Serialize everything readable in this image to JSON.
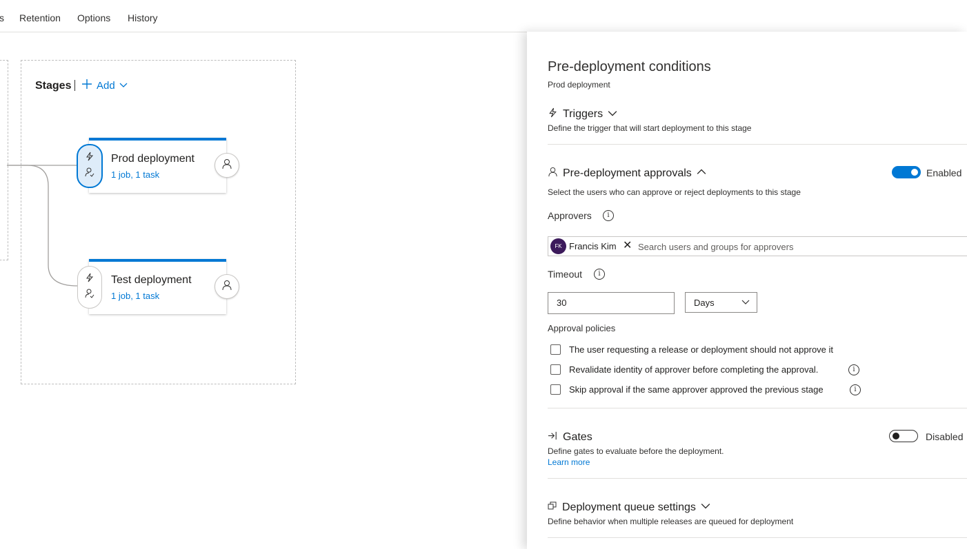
{
  "topnav": {
    "tabs": [
      {
        "label": "s"
      },
      {
        "label": "Retention"
      },
      {
        "label": "Options"
      },
      {
        "label": "History"
      }
    ]
  },
  "pipeline": {
    "stages_title": "Stages",
    "add_label": "Add",
    "stages": [
      {
        "name": "Prod deployment",
        "summary": "1 job, 1 task"
      },
      {
        "name": "Test deployment",
        "summary": "1 job, 1 task"
      }
    ]
  },
  "panel": {
    "title": "Pre-deployment conditions",
    "subtitle": "Prod deployment",
    "triggers": {
      "title": "Triggers",
      "description": "Define the trigger that will start deployment to this stage"
    },
    "approvals": {
      "title": "Pre-deployment approvals",
      "toggle_label": "Enabled",
      "enabled": true,
      "description": "Select the users who can approve or reject deployments to this stage",
      "approvers_label": "Approvers",
      "approver_initials": "FK",
      "approver_name": "Francis Kim",
      "search_placeholder": "Search users and groups for approvers",
      "timeout_label": "Timeout",
      "timeout_value": "30",
      "timeout_unit": "Days",
      "policies_label": "Approval policies",
      "policies": [
        {
          "label": "The user requesting a release or deployment should not approve it",
          "checked": false
        },
        {
          "label": "Revalidate identity of approver before completing the approval.",
          "checked": false
        },
        {
          "label": "Skip approval if the same approver approved the previous stage",
          "checked": false
        }
      ]
    },
    "gates": {
      "title": "Gates",
      "toggle_label": "Disabled",
      "enabled": false,
      "description": "Define gates to evaluate before the deployment.",
      "learn_more": "Learn more"
    },
    "queue": {
      "title": "Deployment queue settings",
      "description": "Define behavior when multiple releases are queued for deployment"
    }
  },
  "colors": {
    "accent": "#0078d4",
    "avatar": "#3c1a5b"
  }
}
